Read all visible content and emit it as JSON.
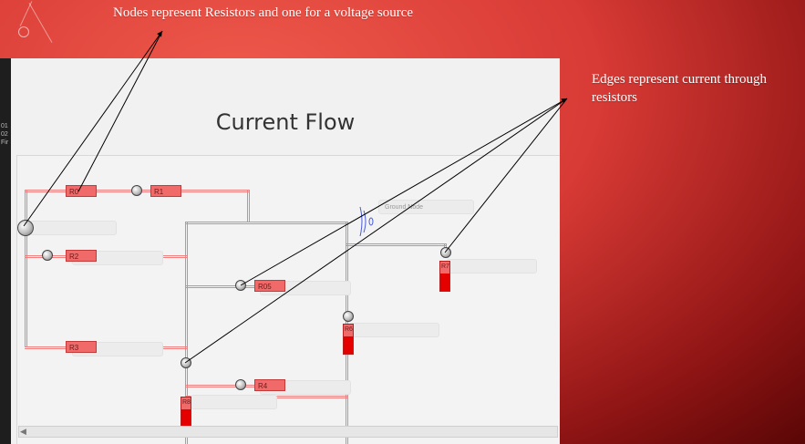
{
  "captions": {
    "nodes": "Nodes represent Resistors and one for a voltage source",
    "edges": "Edges represent current through resistors"
  },
  "window": {
    "title": "Current Flow",
    "ground_label": "Ground Node"
  },
  "resistors": {
    "r0": "R0",
    "r1": "R1",
    "r2": "R2",
    "r3": "R3",
    "r4": "R4",
    "r05": "R05",
    "r6": "R6",
    "r7": "R7",
    "r8": "R8"
  },
  "left_strip": [
    "01",
    "02",
    "Fir"
  ],
  "colors": {
    "background_accent": "#d83a35",
    "wire": "#f08080",
    "resistor": "#f06a6a",
    "resistor_active": "#e50000"
  },
  "icons": {
    "ground": "ground-symbol-icon",
    "scroll_left": "chevron-left-icon"
  }
}
